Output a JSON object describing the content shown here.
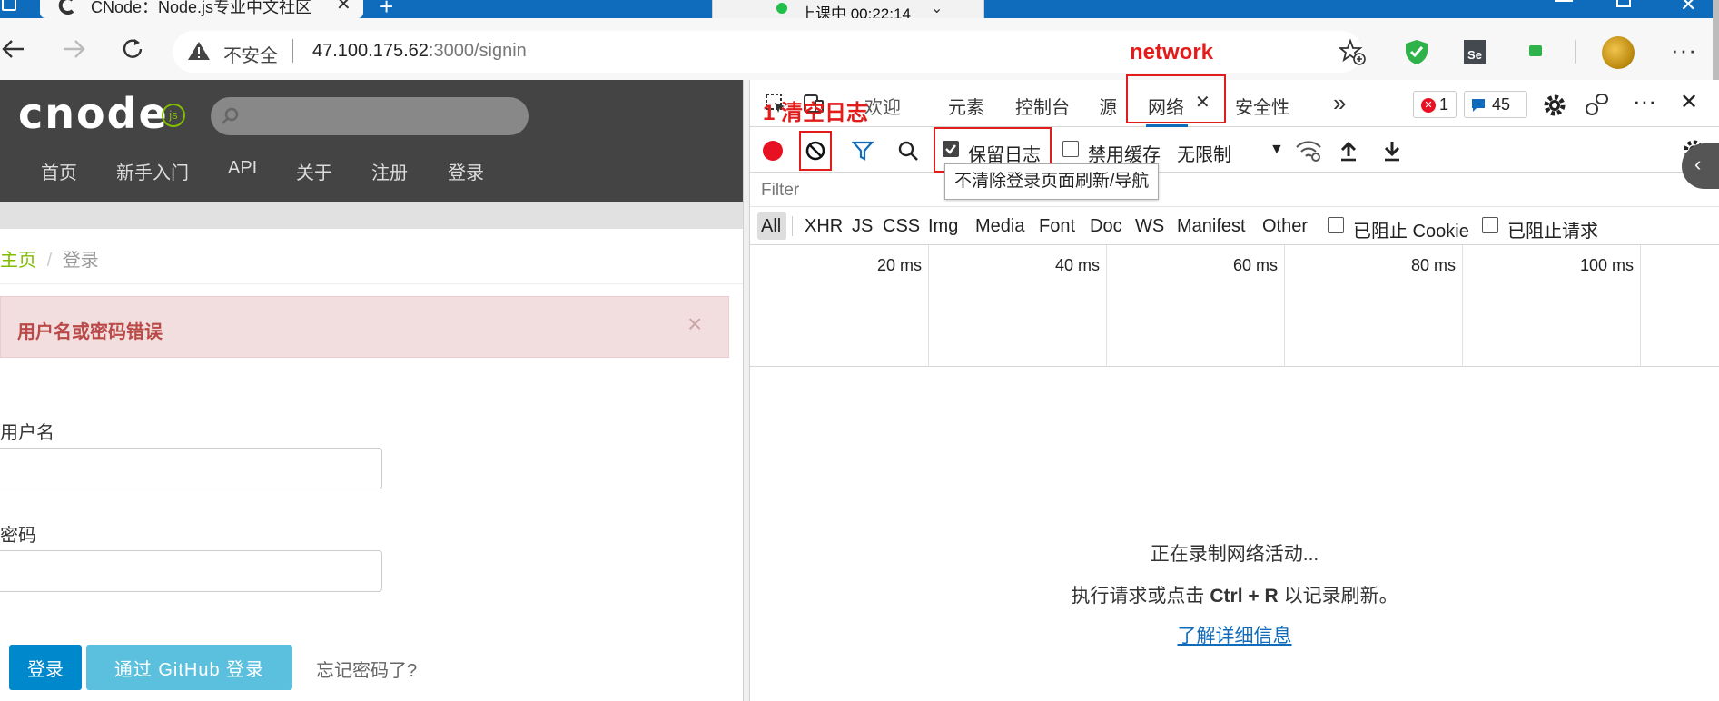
{
  "browser": {
    "tab_title": "CNode：Node.js专业中文社区",
    "recording_pill": "上课中 00:22:14",
    "insecure_label": "不安全",
    "url_host": "47.100.175.62",
    "url_rest": ":3000/signin"
  },
  "annotations": {
    "network": "network",
    "clear_log": "1 清空日志"
  },
  "site": {
    "logo": "cnode",
    "logo_badge": "js",
    "nav": [
      "首页",
      "新手入门",
      "API",
      "关于",
      "注册",
      "登录"
    ],
    "breadcrumb_home": "主页",
    "breadcrumb_sep": "/",
    "breadcrumb_current": "登录",
    "alert_message": "用户名或密码错误",
    "alert_close": "×",
    "username_label": "用户名",
    "password_label": "密码",
    "login_button": "登录",
    "github_button": "通过 GitHub 登录",
    "forgot_link": "忘记密码了?"
  },
  "devtools": {
    "tabs": [
      "欢迎",
      "元素",
      "控制台",
      "源",
      "网络",
      "安全性"
    ],
    "active_tab": "网络",
    "more_tabs": "»",
    "error_count": "1",
    "message_count": "45",
    "preserve_log": "保留日志",
    "preserve_log_checked": true,
    "disable_cache": "禁用缓存",
    "throttling": "无限制",
    "tooltip": "不清除登录页面刷新/导航",
    "filter_placeholder": "Filter",
    "types": [
      "All",
      "XHR",
      "JS",
      "CSS",
      "Img",
      "Media",
      "Font",
      "Doc",
      "WS",
      "Manifest",
      "Other"
    ],
    "blocked_cookies": "已阻止 Cookie",
    "blocked_requests": "已阻止请求",
    "timeline_ticks": [
      "20 ms",
      "40 ms",
      "60 ms",
      "80 ms",
      "100 ms"
    ],
    "empty_line1": "正在录制网络活动...",
    "empty_line2_pre": "执行请求或点击",
    "empty_line2_keys": "Ctrl + R",
    "empty_line2_post": "以记录刷新。",
    "learn_more": "了解详细信息"
  },
  "colors": {
    "annotation_red": "#e21b1b",
    "edge_blue": "#0f6cbd",
    "cnode_green": "#80bd01",
    "site_header": "#444444"
  }
}
